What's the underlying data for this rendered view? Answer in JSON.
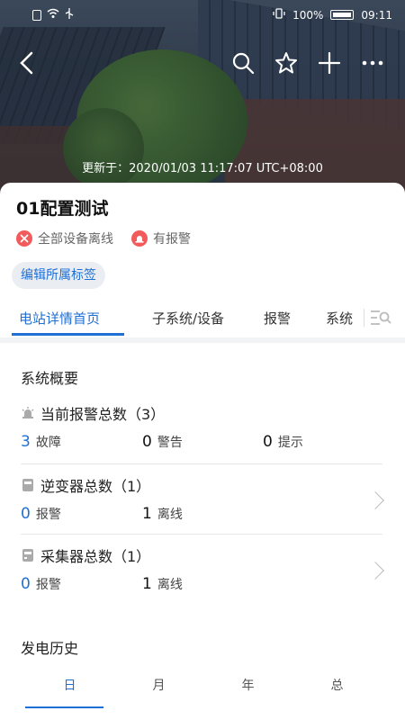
{
  "statusbar": {
    "battery": "100%",
    "time": "09:11"
  },
  "hero": {
    "updated_label": "更新于：2020/01/03 11:17:07 UTC+08:00"
  },
  "station": {
    "title": "01配置测试",
    "status": [
      {
        "icon": "offline-x-icon",
        "text": "全部设备离线"
      },
      {
        "icon": "alarm-icon",
        "text": "有报警"
      }
    ],
    "edit_tag_label": "编辑所属标签"
  },
  "tabs": [
    {
      "label": "电站详情首页",
      "active": true
    },
    {
      "label": "子系统/设备",
      "active": false
    },
    {
      "label": "报警",
      "active": false
    },
    {
      "label": "系统",
      "active": false
    }
  ],
  "overview": {
    "title": "系统概要",
    "alarms": {
      "label": "当前报警总数（3）",
      "stats": [
        {
          "value": "3",
          "label": "故障",
          "highlight": true
        },
        {
          "value": "0",
          "label": "警告",
          "highlight": false
        },
        {
          "value": "0",
          "label": "提示",
          "highlight": false
        }
      ]
    },
    "inverters": {
      "label": "逆变器总数（1）",
      "stats": [
        {
          "value": "0",
          "label": "报警",
          "highlight": true
        },
        {
          "value": "1",
          "label": "离线",
          "highlight": false
        }
      ]
    },
    "collectors": {
      "label": "采集器总数（1）",
      "stats": [
        {
          "value": "0",
          "label": "报警",
          "highlight": true
        },
        {
          "value": "1",
          "label": "离线",
          "highlight": false
        }
      ]
    }
  },
  "history": {
    "title": "发电历史",
    "tabs": [
      "日",
      "月",
      "年",
      "总"
    ]
  },
  "colors": {
    "accent": "#1f6fd4",
    "alert": "#f25b5b"
  }
}
